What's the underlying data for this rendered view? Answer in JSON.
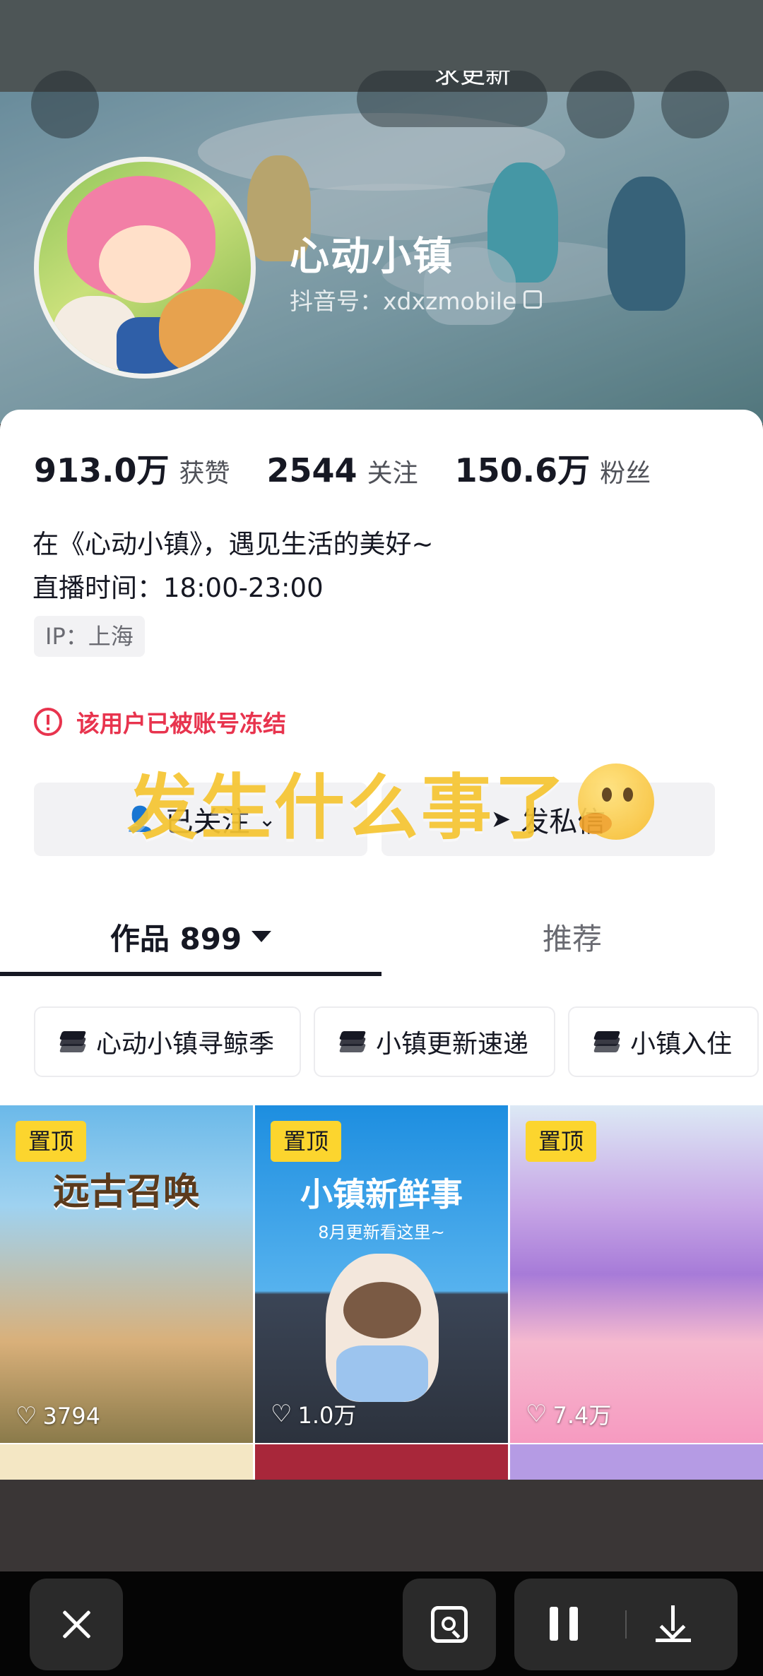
{
  "header": {
    "pill_label": "求更新"
  },
  "profile": {
    "name": "心动小镇",
    "douyin_id": "抖音号：xdxzmobile"
  },
  "stats": [
    {
      "value": "913.0万",
      "label": "获赞"
    },
    {
      "value": "2544",
      "label": "关注"
    },
    {
      "value": "150.6万",
      "label": "粉丝"
    }
  ],
  "bio": {
    "line1": "在《心动小镇》，遇见生活的美好~",
    "line2": "直播时间：18:00-23:00",
    "ip": "IP：上海"
  },
  "status": {
    "frozen_text": "该用户已被账号冻结",
    "color": "#e8344e"
  },
  "actions": {
    "follow_label": "已关注",
    "message_label": "发私信"
  },
  "overlay": {
    "caption": "发生什么事了",
    "color": "#f6c531"
  },
  "tabs": {
    "works_label": "作品 899",
    "recommend_label": "推荐"
  },
  "collections": [
    {
      "label": "心动小镇寻鲸季"
    },
    {
      "label": "小镇更新速递"
    },
    {
      "label": "小镇入住"
    }
  ],
  "videos": [
    {
      "pin": "置顶",
      "title": "远古召唤",
      "likes": "3794"
    },
    {
      "pin": "置顶",
      "title": "小镇新鲜事",
      "subtitle": "8月更新看这里~",
      "likes": "1.0万"
    },
    {
      "pin": "置顶",
      "likes": "7.4万"
    }
  ],
  "icons": {
    "close": "close-icon",
    "scan": "scan-icon",
    "pause": "pause-icon",
    "download": "download-icon"
  }
}
